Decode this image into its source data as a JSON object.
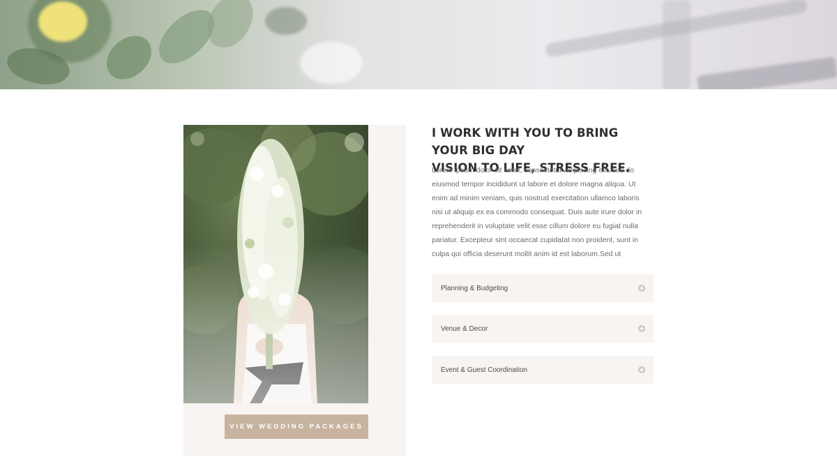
{
  "hero": {
    "image": "hero-photo"
  },
  "feature": {
    "heading_line1": "I WORK WITH YOU TO BRING YOUR BIG DAY",
    "heading_line2": "VISION TO LIFE, STRESS FREE.",
    "body": "Lorem ipsum dolor sit amet, consectetur adipiscing elit, sed do eiusmod tempor incididunt ut labore et dolore magna aliqua. Ut enim ad minim veniam, quis nostrud exercitation ullamco laboris nisi ut aliquip ex ea commodo consequat. Duis aute irure dolor in reprehenderit in voluptate velit esse cillum dolore eu fugiat nulla pariatur. Excepteur sint occaecat cupidatat non proident, sunt in culpa qui officia deserunt mollit anim id est laborum.Sed ut",
    "photo": "bride-holding-flowers-photo",
    "button_label": "VIEW WEDDING PACKAGES"
  },
  "accordion": [
    {
      "title": "Planning & Budgeting",
      "icon": "plus-circle-icon"
    },
    {
      "title": "Venue & Decor",
      "icon": "plus-circle-icon"
    },
    {
      "title": "Event & Guest Coordination",
      "icon": "plus-circle-icon"
    }
  ],
  "colors": {
    "button_bg": "#c8b39e",
    "card_bg": "#f8f4f2",
    "heading": "#2f2f2f",
    "body_text": "#6b6b6b"
  }
}
